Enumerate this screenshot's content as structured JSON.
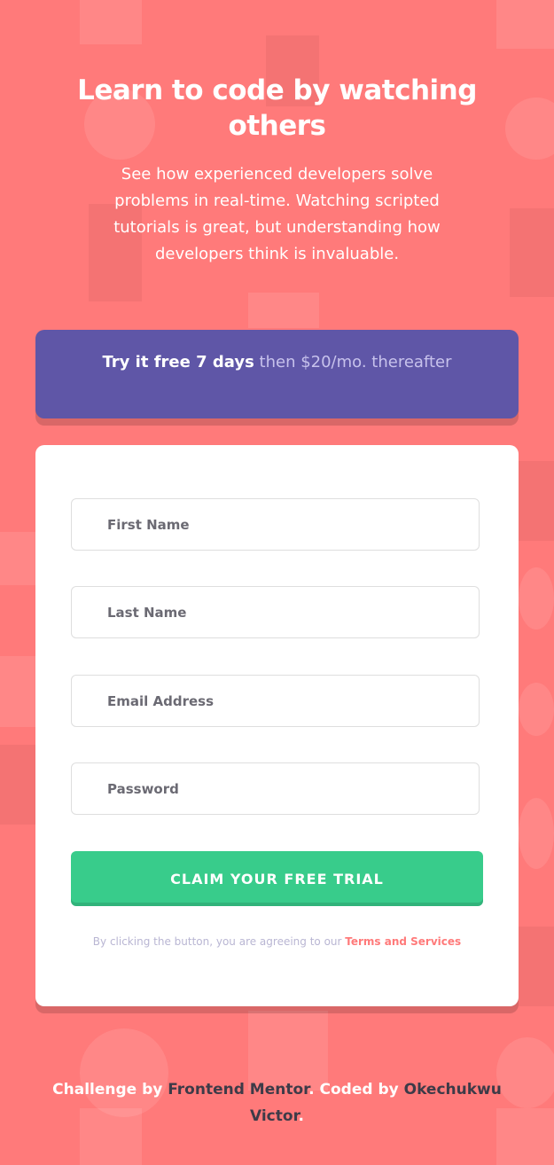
{
  "hero": {
    "title": "Learn to code by watching others",
    "text": "See how experienced developers solve problems in real-time. Watching scripted tutorials is great, but understanding how developers think is invaluable."
  },
  "promo": {
    "strong": "Try it free 7 days",
    "rest": " then $20/mo. thereafter"
  },
  "form": {
    "first_name_placeholder": "First Name",
    "last_name_placeholder": "Last Name",
    "email_placeholder": "Email Address",
    "password_placeholder": "Password",
    "submit_label": "CLAIM YOUR FREE TRIAL",
    "terms_text": "By clicking the button, you are agreeing to our ",
    "terms_link": "Terms and Services"
  },
  "footer": {
    "challenge_by": "Challenge by ",
    "frontend_mentor": "Frontend Mentor",
    "coded_by": ". Coded by ",
    "author": "Okechukwu Victor",
    "end": "."
  },
  "colors": {
    "background": "#ff7a7a",
    "promo": "#5f56a7",
    "cta": "#38cc8b",
    "link": "#ff7a7a",
    "dark_text": "#3d3b48"
  }
}
